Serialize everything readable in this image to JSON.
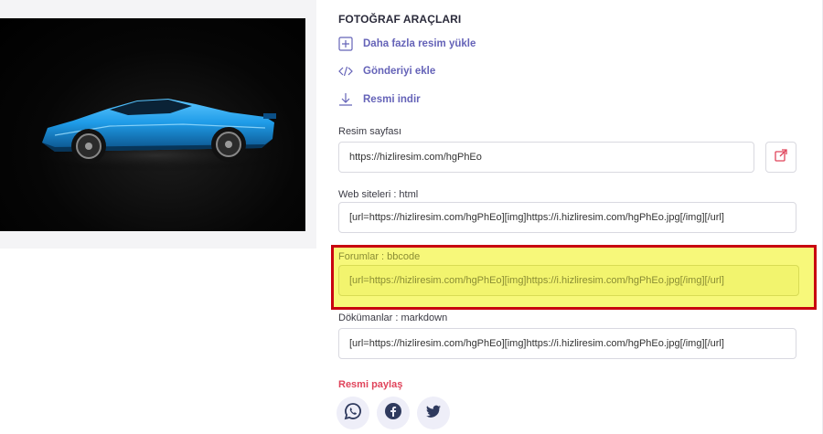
{
  "tools": {
    "title": "FOTOĞRAF ARAÇLARI",
    "actions": [
      {
        "label": "Daha fazla resim yükle",
        "icon": "plus-square-icon"
      },
      {
        "label": "Gönderiyi ekle",
        "icon": "code-icon"
      },
      {
        "label": "Resmi indir",
        "icon": "download-icon"
      }
    ]
  },
  "fields": {
    "image_page": {
      "label": "Resim sayfası",
      "value": "https://hizliresim.com/hgPhEo"
    },
    "website_html": {
      "label": "Web siteleri : html",
      "value": "[url=https://hizliresim.com/hgPhEo][img]https://i.hizliresim.com/hgPhEo.jpg[/img][/url]"
    },
    "forums_bbcode": {
      "label": "Forumlar : bbcode",
      "value": "[url=https://hizliresim.com/hgPhEo][img]https://i.hizliresim.com/hgPhEo.jpg[/img][/url]"
    },
    "docs_markdown": {
      "label": "Dökümanlar : markdown",
      "value": "[url=https://hizliresim.com/hgPhEo][img]https://i.hizliresim.com/hgPhEo.jpg[/img][/url]"
    }
  },
  "share": {
    "title": "Resmi paylaş",
    "networks": [
      "whatsapp-icon",
      "facebook-icon",
      "twitter-icon"
    ]
  },
  "colors": {
    "accent": "#6563b8",
    "share_red": "#e0445b",
    "highlight_yellow": "#f7f87a",
    "highlight_border": "#c8000f",
    "social_icon": "#2f3a5e"
  }
}
